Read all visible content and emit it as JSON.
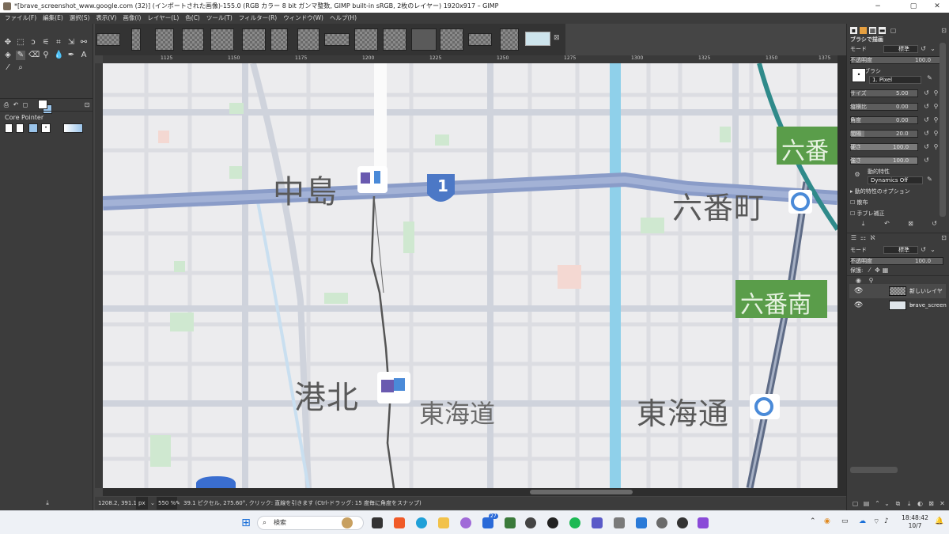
{
  "window": {
    "title": "*[brave_screenshot_www.google.com (32)] (インポートされた画像)-155.0 (RGB カラー 8 bit ガンマ整数, GIMP built-in sRGB, 2枚のレイヤー) 1920x917 – GIMP",
    "minimize": "−",
    "maximize": "▢",
    "close": "✕"
  },
  "menu": [
    "ファイル(F)",
    "編集(E)",
    "選択(S)",
    "表示(V)",
    "画像(I)",
    "レイヤー(L)",
    "色(C)",
    "ツール(T)",
    "フィルター(R)",
    "ウィンドウ(W)",
    "ヘルプ(H)"
  ],
  "toolbox": {
    "device_label": "Core Pointer"
  },
  "ruler": {
    "ticks": [
      "1125",
      "1150",
      "1175",
      "1200",
      "1225",
      "1250",
      "1275",
      "1300",
      "1325",
      "1350",
      "1375"
    ]
  },
  "map": {
    "labels": {
      "nakajima": "中島",
      "kohoku": "港北",
      "tokaido": "東海道",
      "tokaidori": "東海通",
      "rokubancho": "六番町",
      "rokuban_top": "六番",
      "rokuban_minami": "六番南",
      "route_shield": "1"
    }
  },
  "status": {
    "coords": "1208.2, 391.1",
    "unit": "px",
    "zoom": "550 %",
    "message": "39.1 ピクセル, 275.60°, クリック: 直線を引きます (Ctrl-ドラッグ: 15 度毎に角度をスナップ)"
  },
  "tool_options": {
    "title": "ブラシで描画",
    "mode_label": "モード",
    "mode_value": "標準",
    "opacity_label": "不透明度",
    "opacity_value": "100.0",
    "brush_label": "ブラシ",
    "brush_value": "1. Pixel",
    "size_label": "サイズ",
    "size_value": "5.00",
    "aspect_label": "縦横比",
    "aspect_value": "0.00",
    "angle_label": "角度",
    "angle_value": "0.00",
    "spacing_label": "間隔",
    "spacing_value": "20.0",
    "hardness_label": "硬さ",
    "hardness_value": "100.0",
    "force_label": "強さ",
    "force_value": "100.0",
    "dynamics_label": "動的特性",
    "dynamics_value": "Dynamics Off",
    "dynamics_options": "動的特性のオプション",
    "scatter": "散布",
    "smooth": "手ブレ補正"
  },
  "layers": {
    "mode_label": "モード",
    "mode_value": "標準",
    "opacity_label": "不透明度",
    "opacity_value": "100.0",
    "lock_label": "保護:",
    "items": [
      {
        "name": "新しいレイヤー"
      },
      {
        "name": "brave_screen"
      }
    ]
  },
  "taskbar": {
    "search_placeholder": "検索",
    "time": "18:48:42",
    "date": "10/7",
    "badge": "27"
  }
}
